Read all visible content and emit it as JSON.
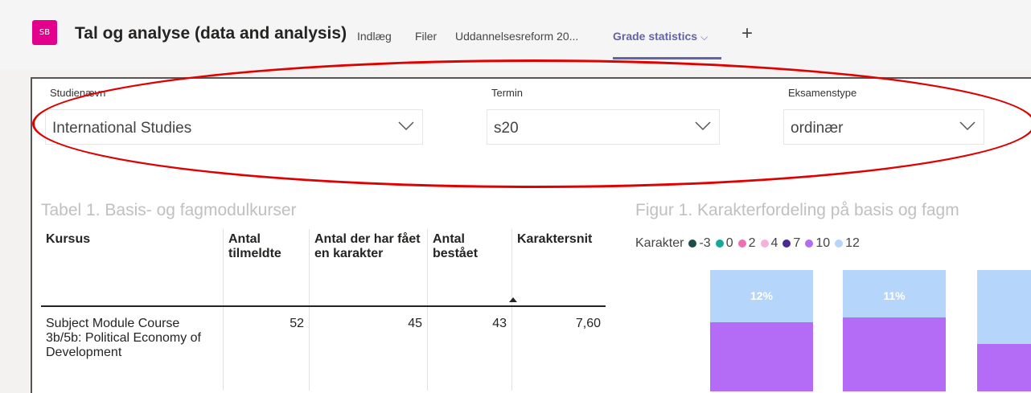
{
  "header": {
    "avatar_initials": "SB",
    "team_title": "Tal og analyse (data and analysis)",
    "tabs": [
      {
        "label": "Indlæg"
      },
      {
        "label": "Filer"
      },
      {
        "label": "Uddannelsesreform 20..."
      },
      {
        "label": "Grade statistics"
      }
    ],
    "active_chevron": "⌵",
    "add_tab": "+"
  },
  "slicers": [
    {
      "label": "Studienævn",
      "value": "International Studies"
    },
    {
      "label": "Termin",
      "value": "s20"
    },
    {
      "label": "Eksamenstype",
      "value": "ordinær"
    }
  ],
  "table": {
    "title": "Tabel 1. Basis- og fagmodulkurser",
    "columns": [
      "Kursus",
      "Antal tilmeldte",
      "Antal der har fået en karakter",
      "Antal bestået",
      "Karaktersnit"
    ],
    "rows": [
      {
        "course": "Subject Module Course 3b/5b: Political Economy of Development",
        "enrolled": "52",
        "graded": "45",
        "passed": "43",
        "average": "7,60"
      }
    ]
  },
  "chart_data": {
    "type": "bar",
    "title": "Figur 1. Karakterfordeling på basis og fagm",
    "legend_title": "Karakter",
    "legend_position": "top-left",
    "series": [
      {
        "name": "-3",
        "color": "#1b4d4b"
      },
      {
        "name": "0",
        "color": "#15a99b"
      },
      {
        "name": "2",
        "color": "#ef6fb5"
      },
      {
        "name": "4",
        "color": "#f5b1dc"
      },
      {
        "name": "7",
        "color": "#4b2a96"
      },
      {
        "name": "10",
        "color": "#b46bf5"
      },
      {
        "name": "12",
        "color": "#b5d5fb"
      }
    ],
    "bars": [
      {
        "share_12": 0.12,
        "label_12": "12%"
      },
      {
        "share_12": 0.11,
        "label_12": "11%"
      },
      {
        "share_12": 0.17,
        "label_12": ""
      }
    ]
  },
  "colors": {
    "accent": "#6264a7",
    "avatar": "#e3008c",
    "highlight": "#e00000"
  }
}
